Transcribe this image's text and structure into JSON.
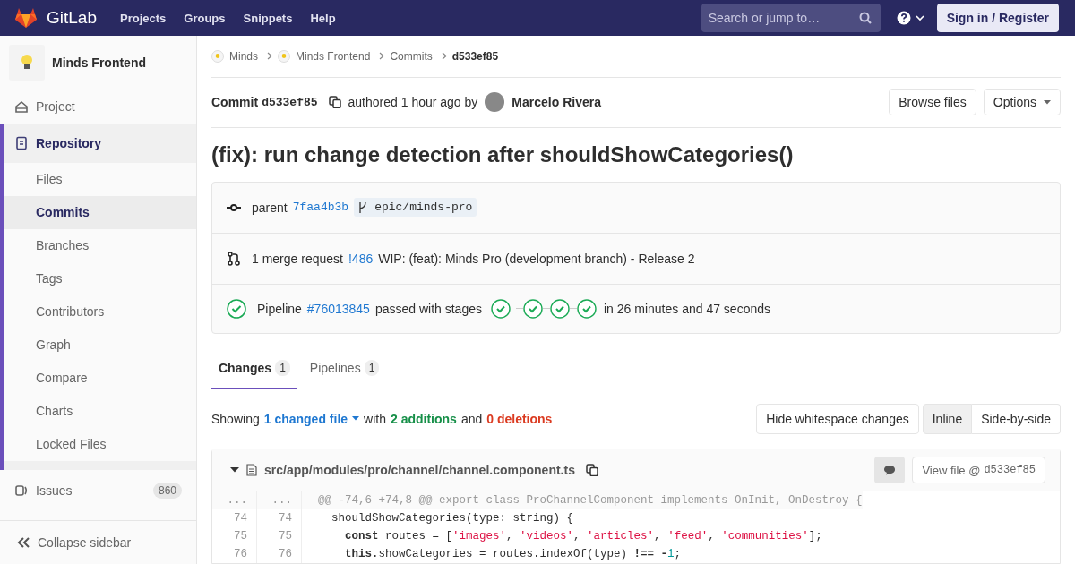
{
  "header": {
    "brand": "GitLab",
    "nav": [
      "Projects",
      "Groups",
      "Snippets",
      "Help"
    ],
    "search": {
      "placeholder": "Search or jump to…"
    },
    "sign_in": "Sign in / Register"
  },
  "sidebar": {
    "project": "Minds Frontend",
    "items": [
      {
        "label": "Project",
        "selected": false
      },
      {
        "label": "Repository",
        "selected": true,
        "children": [
          {
            "label": "Files",
            "selected": false
          },
          {
            "label": "Commits",
            "selected": true
          },
          {
            "label": "Branches",
            "selected": false
          },
          {
            "label": "Tags",
            "selected": false
          },
          {
            "label": "Contributors",
            "selected": false
          },
          {
            "label": "Graph",
            "selected": false
          },
          {
            "label": "Compare",
            "selected": false
          },
          {
            "label": "Charts",
            "selected": false
          },
          {
            "label": "Locked Files",
            "selected": false
          }
        ]
      },
      {
        "label": "Issues",
        "selected": false,
        "count": "860"
      }
    ],
    "collapse": "Collapse sidebar"
  },
  "breadcrumbs": [
    "Minds",
    "Minds Frontend",
    "Commits",
    "d533ef85"
  ],
  "commit": {
    "label": "Commit",
    "sha": "d533ef85",
    "authored": "authored 1 hour ago by",
    "author": "Marcelo Rivera",
    "buttons": [
      "Browse files",
      "Options"
    ],
    "title": "(fix): run change detection after shouldShowCategories()",
    "parent": {
      "label": "parent",
      "sha": "7faa4b3b",
      "branch": "epic/minds-pro"
    },
    "merge": {
      "label": "1 merge request",
      "ref": "!486",
      "title": "WIP: (feat): Minds Pro (development branch) - Release 2"
    },
    "pipeline": {
      "label": "Pipeline",
      "ref": "#76013845",
      "text": "passed with stages",
      "stages": [
        {
          "passed": true
        },
        {
          "passed": true
        },
        {
          "passed": true
        },
        {
          "passed": true
        }
      ],
      "duration": "in 26 minutes and 47 seconds"
    }
  },
  "tabs": [
    {
      "label": "Changes",
      "count": "1",
      "selected": true
    },
    {
      "label": "Pipelines",
      "count": "1",
      "selected": false
    }
  ],
  "summary": {
    "showing": "Showing",
    "files": "1 changed file",
    "with": "with",
    "additions": "2 additions",
    "and": "and",
    "deletions": "0 deletions"
  },
  "whitespace_button": "Hide whitespace changes",
  "view_modes": [
    {
      "label": "Inline",
      "selected": true
    },
    {
      "label": "Side-by-side",
      "selected": false
    }
  ],
  "file": {
    "path": "src/app/modules/pro/channel/channel.component.ts",
    "view": "View file @",
    "view_sha": "d533ef85",
    "lines": [
      {
        "kind": "hunk",
        "old": "...",
        "new": "...",
        "tokens": [
          {
            "t": "@@ -74,6 +74,8 @@ export class ProChannelComponent implements OnInit, OnDestroy {",
            "kind": "plain"
          }
        ]
      },
      {
        "kind": "context",
        "old": "74",
        "new": "74",
        "tokens": [
          {
            "t": "  shouldShowCategories(type: string) {",
            "kind": "plain"
          }
        ]
      },
      {
        "kind": "context",
        "old": "75",
        "new": "75",
        "tokens": [
          {
            "t": "    const",
            "kind": "kw"
          },
          {
            "t": " routes = [",
            "kind": "plain"
          },
          {
            "t": "'images'",
            "kind": "str"
          },
          {
            "t": ", ",
            "kind": "plain"
          },
          {
            "t": "'videos'",
            "kind": "str"
          },
          {
            "t": ", ",
            "kind": "plain"
          },
          {
            "t": "'articles'",
            "kind": "str"
          },
          {
            "t": ", ",
            "kind": "plain"
          },
          {
            "t": "'feed'",
            "kind": "str"
          },
          {
            "t": ", ",
            "kind": "plain"
          },
          {
            "t": "'communities'",
            "kind": "str"
          },
          {
            "t": "];",
            "kind": "plain"
          }
        ]
      },
      {
        "kind": "context",
        "old": "76",
        "new": "76",
        "tokens": [
          {
            "t": "    this",
            "kind": "kw"
          },
          {
            "t": ".showCategories = routes.indexOf(type) ",
            "kind": "plain"
          },
          {
            "t": "!== -",
            "kind": "kw"
          },
          {
            "t": "1",
            "kind": "num"
          },
          {
            "t": ";",
            "kind": "plain"
          }
        ]
      }
    ]
  }
}
